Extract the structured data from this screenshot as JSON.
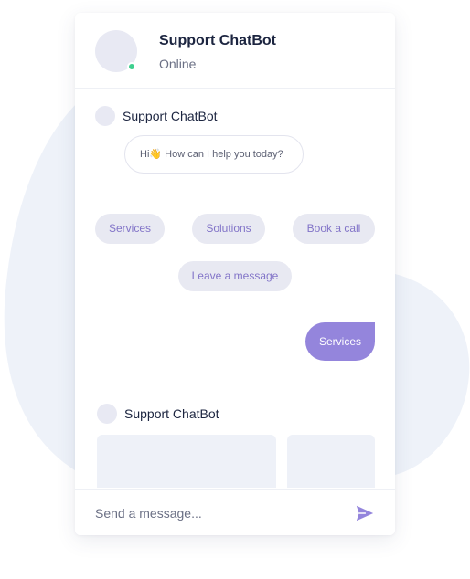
{
  "header": {
    "title": "Support ChatBot",
    "status": "Online"
  },
  "messages": {
    "bot_name": "Support ChatBot",
    "greeting": "Hi👋 How can I help you today?",
    "quick_replies": [
      "Services",
      "Solutions",
      "Book a call",
      "Leave a message"
    ],
    "user_message": "Services"
  },
  "input": {
    "placeholder": "Send a message..."
  },
  "colors": {
    "accent": "#9485dc",
    "chip_text": "#8274c8",
    "chip_bg": "#e8e9f2",
    "online": "#3ecf8e",
    "background_blob": "#eef2f9"
  },
  "icons": {
    "send": "send-icon"
  }
}
